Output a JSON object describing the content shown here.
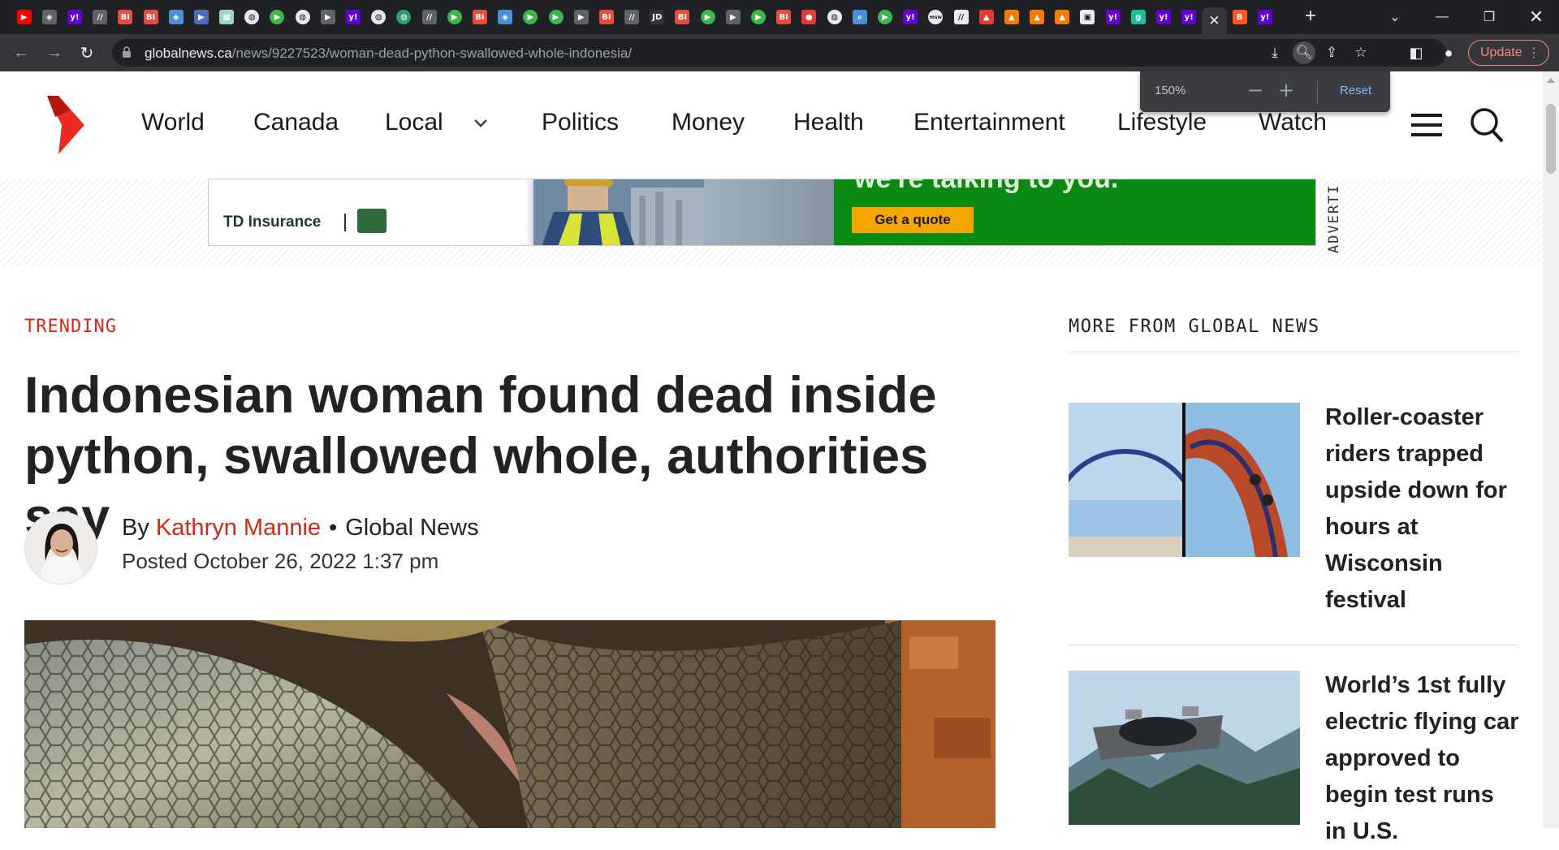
{
  "browser": {
    "url_host": "globalnews.ca",
    "url_path": "/news/9227523/woman-dead-python-swallowed-whole-indonesia/",
    "update_label": "Update",
    "zoom": {
      "percent": "150%",
      "reset_label": "Reset"
    },
    "tabs": [
      {
        "icon": "youtube-icon",
        "color": "#ff0000"
      },
      {
        "icon": "shield-icon",
        "color": "#5f6368"
      },
      {
        "icon": "yahoo-icon",
        "color": "#6001d2"
      },
      {
        "icon": "wsj-icon",
        "color": "#5f6368"
      },
      {
        "icon": "business-insider-icon",
        "color": "#e64d3d"
      },
      {
        "icon": "business-insider-icon",
        "color": "#e64d3d"
      },
      {
        "icon": "shield-icon",
        "color": "#4a90d9"
      },
      {
        "icon": "arrow-right-icon",
        "color": "#4b6cb7"
      },
      {
        "icon": "image-icon",
        "color": "#9fd3c7"
      },
      {
        "icon": "globe-icon",
        "color": "#e8eaed"
      },
      {
        "icon": "play-icon",
        "color": "#3cb54a"
      },
      {
        "icon": "globe-icon",
        "color": "#e8eaed"
      },
      {
        "icon": "arrow-right-icon",
        "color": "#5f6368"
      },
      {
        "icon": "yahoo-icon",
        "color": "#6001d2"
      },
      {
        "icon": "globe-icon",
        "color": "#e8eaed"
      },
      {
        "icon": "globe-icon",
        "color": "#2e9e6a"
      },
      {
        "icon": "wsj-icon",
        "color": "#5f6368"
      },
      {
        "icon": "play-icon",
        "color": "#3cb54a"
      },
      {
        "icon": "business-insider-icon",
        "color": "#e64d3d"
      },
      {
        "icon": "shield-icon",
        "color": "#4a90d9"
      },
      {
        "icon": "play-icon",
        "color": "#3cb54a"
      },
      {
        "icon": "play-icon",
        "color": "#3cb54a"
      },
      {
        "icon": "arrow-right-icon",
        "color": "#5f6368"
      },
      {
        "icon": "business-insider-icon",
        "color": "#e64d3d"
      },
      {
        "icon": "wsj-icon",
        "color": "#5f6368"
      },
      {
        "icon": "jd-icon",
        "color": "#333333"
      },
      {
        "icon": "business-insider-icon",
        "color": "#e64d3d"
      },
      {
        "icon": "play-icon",
        "color": "#3cb54a"
      },
      {
        "icon": "arrow-right-icon",
        "color": "#5f6368"
      },
      {
        "icon": "play-icon",
        "color": "#3cb54a"
      },
      {
        "icon": "business-insider-icon",
        "color": "#e64d3d"
      },
      {
        "icon": "mic-icon",
        "color": "#e53935"
      },
      {
        "icon": "globe-icon",
        "color": "#e8eaed"
      },
      {
        "icon": "search-icon",
        "color": "#4a90d9"
      },
      {
        "icon": "play-icon",
        "color": "#3cb54a"
      },
      {
        "icon": "yahoo-icon",
        "color": "#6001d2"
      },
      {
        "icon": "msw-icon",
        "color": "#e8eaed"
      },
      {
        "icon": "wsj-icon",
        "color": "#e8eaed"
      },
      {
        "icon": "bookmark-icon",
        "color": "#e53935"
      },
      {
        "icon": "bookmark-icon",
        "color": "#f57c00"
      },
      {
        "icon": "bookmark-icon",
        "color": "#f57c00"
      },
      {
        "icon": "bookmark-icon",
        "color": "#f57c00"
      },
      {
        "icon": "lock-icon",
        "color": "#e8eaed"
      },
      {
        "icon": "yahoo-icon",
        "color": "#6001d2"
      },
      {
        "icon": "grammarly-icon",
        "color": "#15c39a"
      },
      {
        "icon": "yahoo-icon",
        "color": "#6001d2"
      },
      {
        "icon": "yahoo-icon",
        "color": "#6001d2"
      },
      {
        "icon": "close-icon",
        "color": "#e8eaed",
        "active": true
      },
      {
        "icon": "blogger-icon",
        "color": "#ff5722"
      },
      {
        "icon": "yahoo-icon",
        "color": "#6001d2"
      }
    ]
  },
  "site": {
    "brand_color": "#ea2b1f",
    "nav": [
      "World",
      "Canada",
      "Local",
      "Politics",
      "Money",
      "Health",
      "Entertainment",
      "Lifestyle",
      "Watch"
    ]
  },
  "ad": {
    "brand": "TD Insurance",
    "headline": "we're talking to you.",
    "cta": "Get a quote",
    "label": "ADVERTI"
  },
  "article": {
    "kicker": "TRENDING",
    "headline": "Indonesian woman found dead inside python, swallowed whole, authorities say",
    "byline_prefix": "By",
    "author": "Kathryn Mannie",
    "outlet": "Global News",
    "posted": "Posted October 26, 2022 1:37 pm"
  },
  "sidebar": {
    "title": "MORE FROM GLOBAL NEWS",
    "stories": [
      {
        "title": "Roller-coaster riders trapped upside down for hours at Wisconsin festival"
      },
      {
        "title": "World’s 1st fully electric flying car approved to begin test runs in U.S."
      }
    ]
  }
}
